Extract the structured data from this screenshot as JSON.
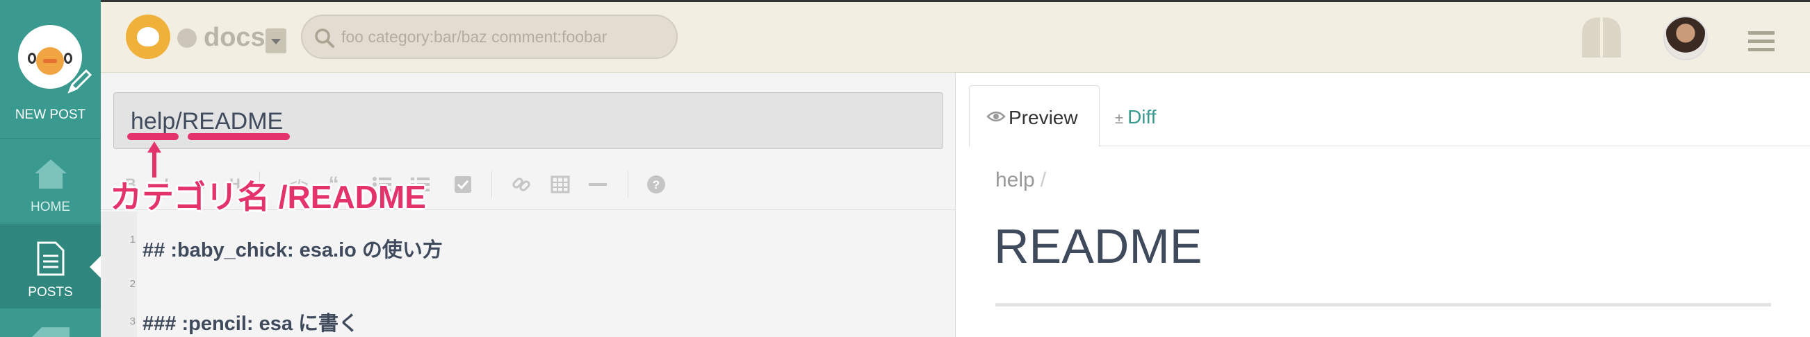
{
  "sidebar": {
    "new_post_label": "NEW POST",
    "items": [
      {
        "label": "HOME",
        "icon": "home-icon"
      },
      {
        "label": "POSTS",
        "icon": "document-icon",
        "active": true
      }
    ]
  },
  "header": {
    "team_name": "docs",
    "search_placeholder": "foo category:bar/baz comment:foobar"
  },
  "editor": {
    "title_value": "help/README",
    "annotation": "カテゴリ名 /README",
    "toolbar": [
      {
        "label": "B",
        "icon": "bold-icon"
      },
      {
        "label": "I",
        "icon": "italic-icon"
      },
      {
        "label": "S",
        "icon": "strikethrough-icon"
      },
      {
        "label": "H",
        "icon": "heading-icon"
      },
      {
        "label": "</>",
        "icon": "code-icon"
      },
      {
        "label": "“",
        "icon": "quote-icon"
      },
      {
        "label": "",
        "icon": "bullet-list-icon"
      },
      {
        "label": "",
        "icon": "numbered-list-icon"
      },
      {
        "label": "",
        "icon": "checkbox-icon"
      },
      {
        "label": "",
        "icon": "link-icon"
      },
      {
        "label": "",
        "icon": "table-icon"
      },
      {
        "label": "",
        "icon": "horizontal-rule-icon"
      },
      {
        "label": "",
        "icon": "help-icon"
      }
    ],
    "lines": [
      {
        "n": "1",
        "text": "## :baby_chick: esa.io の使い方"
      },
      {
        "n": "2",
        "text": ""
      },
      {
        "n": "3",
        "text": "### :pencil: esa に書く"
      }
    ]
  },
  "preview": {
    "tab_preview": "Preview",
    "tab_diff": "Diff",
    "tab_diff_prefix": "±",
    "category": "help",
    "category_sep": "/",
    "title": "README"
  },
  "colors": {
    "sidebar": "#3a9a8f",
    "header": "#f2eee1",
    "annotation": "#e4336b",
    "accent": "#3a9a8f"
  }
}
